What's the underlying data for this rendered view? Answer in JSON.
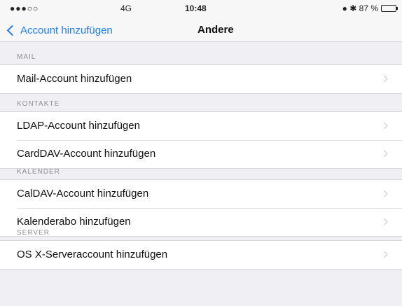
{
  "status_bar": {
    "signal": "●●●○○",
    "carrier": "4G",
    "time": "10:48",
    "right": "● ✱ 87 %"
  },
  "nav": {
    "back_label": "Account hinzufügen",
    "title": "Andere"
  },
  "sections": {
    "mail": {
      "header": "MAIL",
      "items": [
        "Mail-Account hinzufügen"
      ]
    },
    "kontakte": {
      "header": "KONTAKTE",
      "items": [
        "LDAP-Account hinzufügen",
        "CardDAV-Account hinzufügen"
      ]
    },
    "kalender": {
      "header": "KALENDER",
      "items": [
        "CalDAV-Account hinzufügen",
        "Kalenderabo hinzufügen"
      ]
    },
    "server": {
      "header": "SERVER",
      "items": [
        "OS X-Serveraccount hinzufügen"
      ]
    }
  },
  "colors": {
    "accent": "#1f7cf2",
    "background": "#efeff4"
  },
  "icons": {
    "back": "chevron-left-icon",
    "disclosure": "chevron-right-icon"
  }
}
